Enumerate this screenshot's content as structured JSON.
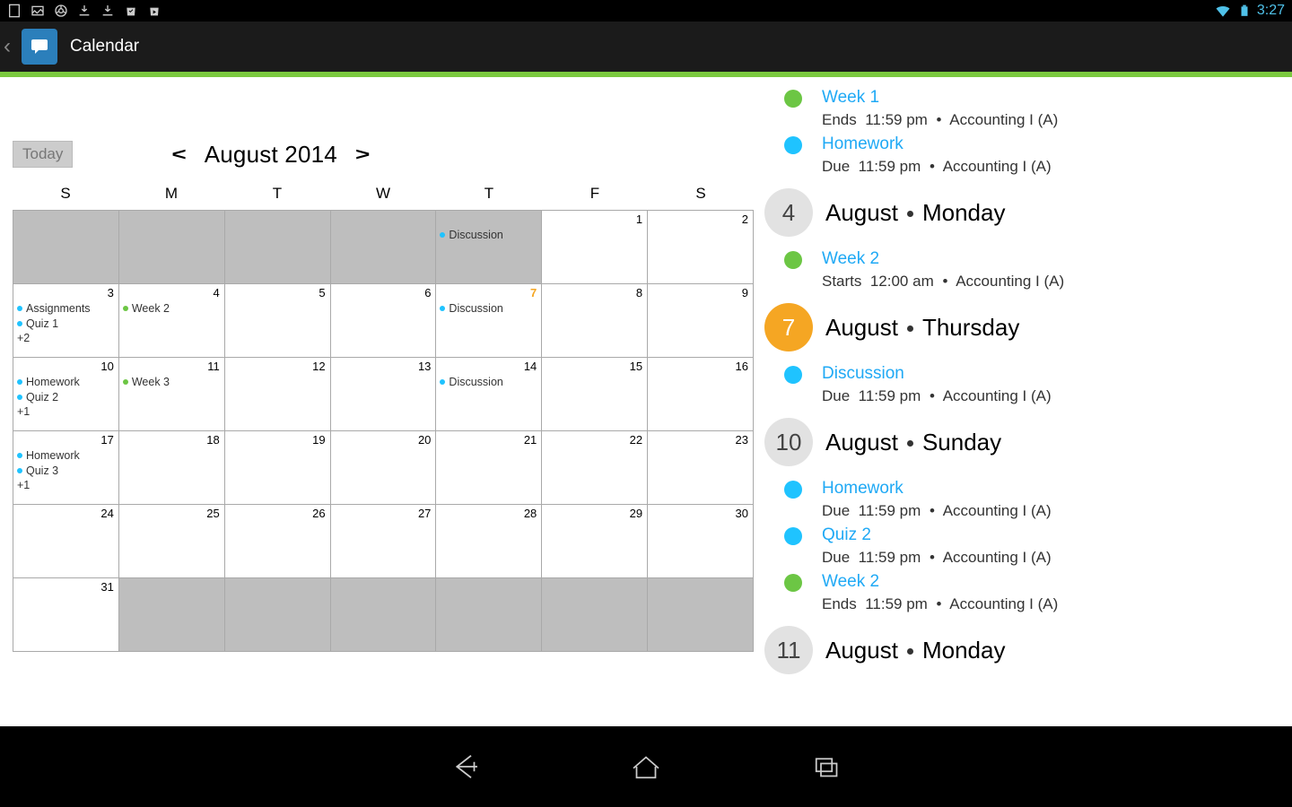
{
  "status": {
    "clock": "3:27"
  },
  "app": {
    "title": "Calendar"
  },
  "calendar": {
    "today_button": "Today",
    "month": "August 2014",
    "prev": "<",
    "next": ">",
    "weekdays": [
      "S",
      "M",
      "T",
      "W",
      "T",
      "F",
      "S"
    ],
    "cells": [
      {
        "n": "",
        "muted": true
      },
      {
        "n": "",
        "muted": true
      },
      {
        "n": "",
        "muted": true
      },
      {
        "n": "",
        "muted": true
      },
      {
        "n": "",
        "muted": true,
        "events": [
          {
            "c": "blue",
            "t": "Discussion"
          }
        ]
      },
      {
        "n": "1"
      },
      {
        "n": "2"
      },
      {
        "n": "3",
        "events": [
          {
            "c": "blue",
            "t": "Assignments"
          },
          {
            "c": "blue",
            "t": "Quiz 1"
          }
        ],
        "more": "+2"
      },
      {
        "n": "4",
        "events": [
          {
            "c": "green",
            "t": "Week 2"
          }
        ]
      },
      {
        "n": "5"
      },
      {
        "n": "6"
      },
      {
        "n": "7",
        "sel": true,
        "events": [
          {
            "c": "blue",
            "t": "Discussion"
          }
        ]
      },
      {
        "n": "8"
      },
      {
        "n": "9"
      },
      {
        "n": "10",
        "events": [
          {
            "c": "blue",
            "t": "Homework"
          },
          {
            "c": "blue",
            "t": "Quiz 2"
          }
        ],
        "more": "+1"
      },
      {
        "n": "11",
        "events": [
          {
            "c": "green",
            "t": "Week 3"
          }
        ]
      },
      {
        "n": "12"
      },
      {
        "n": "13"
      },
      {
        "n": "14",
        "events": [
          {
            "c": "blue",
            "t": "Discussion"
          }
        ]
      },
      {
        "n": "15"
      },
      {
        "n": "16"
      },
      {
        "n": "17",
        "events": [
          {
            "c": "blue",
            "t": "Homework"
          },
          {
            "c": "blue",
            "t": "Quiz 3"
          }
        ],
        "more": "+1"
      },
      {
        "n": "18"
      },
      {
        "n": "19"
      },
      {
        "n": "20"
      },
      {
        "n": "21"
      },
      {
        "n": "22"
      },
      {
        "n": "23"
      },
      {
        "n": "24"
      },
      {
        "n": "25"
      },
      {
        "n": "26"
      },
      {
        "n": "27"
      },
      {
        "n": "28"
      },
      {
        "n": "29"
      },
      {
        "n": "30"
      },
      {
        "n": "31"
      },
      {
        "n": "",
        "muted": true
      },
      {
        "n": "",
        "muted": true
      },
      {
        "n": "",
        "muted": true
      },
      {
        "n": "",
        "muted": true
      },
      {
        "n": "",
        "muted": true
      },
      {
        "n": "",
        "muted": true
      }
    ]
  },
  "agenda": {
    "course": "Accounting I (A)",
    "sections": [
      {
        "type": "item",
        "color": "green",
        "title": "Week 1",
        "prefix": "Ends",
        "time": "11:59 pm"
      },
      {
        "type": "item",
        "color": "blue",
        "title": "Homework",
        "prefix": "Due",
        "time": "11:59 pm"
      },
      {
        "type": "day",
        "num": "4",
        "month": "August",
        "weekday": "Monday",
        "style": "grey"
      },
      {
        "type": "item",
        "color": "green",
        "title": "Week 2",
        "prefix": "Starts",
        "time": "12:00 am"
      },
      {
        "type": "day",
        "num": "7",
        "month": "August",
        "weekday": "Thursday",
        "style": "orange"
      },
      {
        "type": "item",
        "color": "blue",
        "title": "Discussion",
        "prefix": "Due",
        "time": "11:59 pm"
      },
      {
        "type": "day",
        "num": "10",
        "month": "August",
        "weekday": "Sunday",
        "style": "grey"
      },
      {
        "type": "item",
        "color": "blue",
        "title": "Homework",
        "prefix": "Due",
        "time": "11:59 pm"
      },
      {
        "type": "item",
        "color": "blue",
        "title": "Quiz 2",
        "prefix": "Due",
        "time": "11:59 pm"
      },
      {
        "type": "item",
        "color": "green",
        "title": "Week 2",
        "prefix": "Ends",
        "time": "11:59 pm"
      },
      {
        "type": "day",
        "num": "11",
        "month": "August",
        "weekday": "Monday",
        "style": "grey"
      }
    ]
  }
}
